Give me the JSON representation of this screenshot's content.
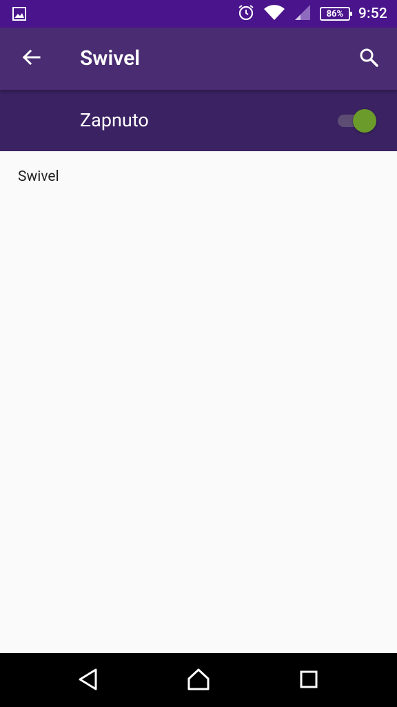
{
  "status_bar": {
    "time": "9:52",
    "battery": "86%",
    "icons": [
      "gallery-icon",
      "alarm-icon",
      "wifi-icon",
      "signal-icon",
      "battery-icon"
    ]
  },
  "app_bar": {
    "title": "Swivel",
    "back_icon": "arrow-back-icon",
    "search_icon": "search-icon"
  },
  "master_switch": {
    "label": "Zapnuto",
    "state": true
  },
  "content": {
    "text": "Swivel"
  },
  "nav_bar": {
    "buttons": [
      "back-icon",
      "home-icon",
      "recents-icon"
    ]
  },
  "colors": {
    "status_bar": "#4a148c",
    "app_bar": "#4a2c72",
    "switch_bar": "#3b2263",
    "toggle_thumb": "#6a9b2b"
  }
}
